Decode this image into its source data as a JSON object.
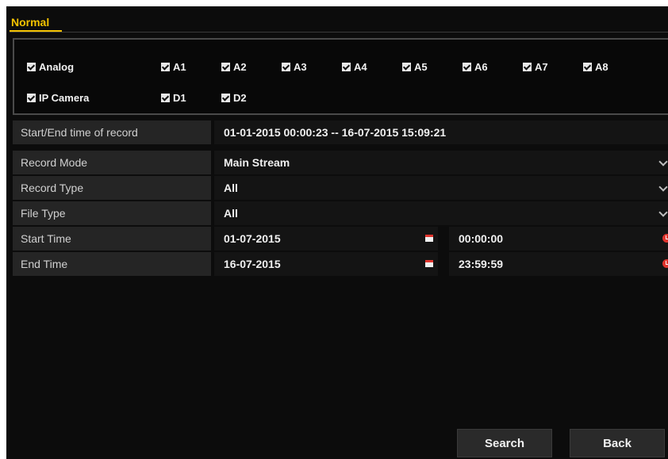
{
  "tab": {
    "label": "Normal"
  },
  "channels": {
    "analog": {
      "label": "Analog",
      "checked": true
    },
    "analog_items": [
      {
        "label": "A1",
        "checked": true
      },
      {
        "label": "A2",
        "checked": true
      },
      {
        "label": "A3",
        "checked": true
      },
      {
        "label": "A4",
        "checked": true
      },
      {
        "label": "A5",
        "checked": true
      },
      {
        "label": "A6",
        "checked": true
      },
      {
        "label": "A7",
        "checked": true
      },
      {
        "label": "A8",
        "checked": true
      }
    ],
    "ip": {
      "label": "IP Camera",
      "checked": true
    },
    "ip_items": [
      {
        "label": "D1",
        "checked": true
      },
      {
        "label": "D2",
        "checked": true
      }
    ]
  },
  "form": {
    "record_time": {
      "label": "Start/End time of record",
      "value": "01-01-2015 00:00:23 -- 16-07-2015 15:09:21"
    },
    "record_mode": {
      "label": "Record Mode",
      "value": "Main Stream"
    },
    "record_type": {
      "label": "Record Type",
      "value": "All"
    },
    "file_type": {
      "label": "File Type",
      "value": "All"
    },
    "start_time": {
      "label": "Start Time",
      "date": "01-07-2015",
      "time": "00:00:00"
    },
    "end_time": {
      "label": "End Time",
      "date": "16-07-2015",
      "time": "23:59:59"
    }
  },
  "buttons": {
    "search": "Search",
    "back": "Back"
  },
  "icons": {
    "checkbox": "checkbox-checked-icon",
    "dropdown": "chevron-down-icon",
    "calendar": "calendar-icon",
    "clock": "clock-icon"
  },
  "colors": {
    "accent": "#f2c200",
    "icon_red": "#e0342d",
    "background": "#0c0c0c"
  }
}
